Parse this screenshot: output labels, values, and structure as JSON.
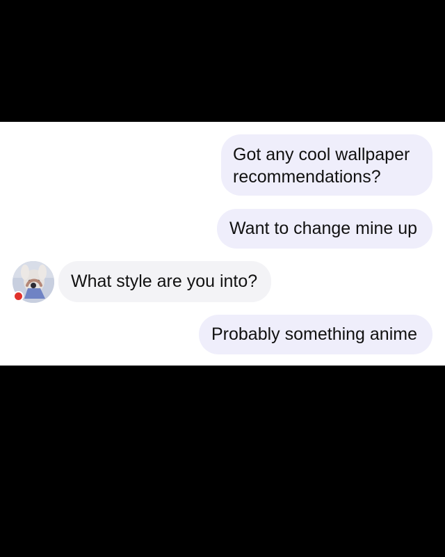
{
  "colors": {
    "letterbox": "#000000",
    "chat_background": "#ffffff",
    "outgoing_bubble": "#efeefb",
    "incoming_bubble": "#f3f3f6",
    "text": "#111111",
    "status_dot": "#e0322c"
  },
  "conversation": {
    "messages": [
      {
        "sender": "me",
        "text": "Got any cool wallpaper recommendations?"
      },
      {
        "sender": "me",
        "text": "Want to change mine up"
      },
      {
        "sender": "contact",
        "text": "What style are you into?"
      },
      {
        "sender": "me",
        "text": "Probably something anime"
      }
    ],
    "contact_avatar": {
      "icon": "profile-photo",
      "status_icon": "red-status-dot"
    }
  }
}
